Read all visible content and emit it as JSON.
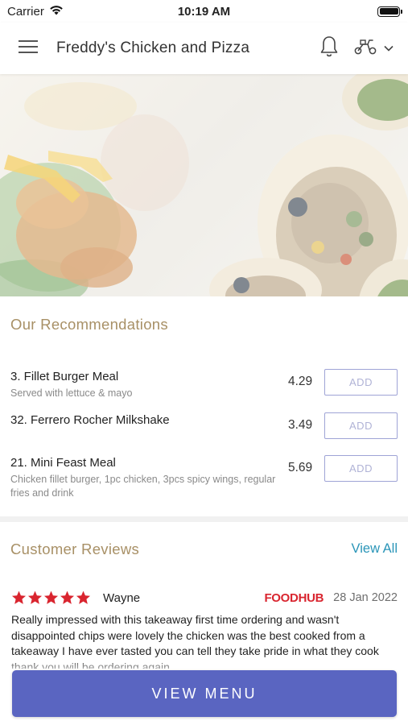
{
  "status_bar": {
    "carrier": "Carrier",
    "time": "10:19 AM"
  },
  "header": {
    "title": "Freddy's Chicken and Pizza",
    "icons": [
      "hamburger-menu-icon",
      "bell-icon",
      "scooter-icon",
      "chevron-down-icon"
    ]
  },
  "recommendations": {
    "title": "Our Recommendations",
    "add_label": "ADD",
    "items": [
      {
        "name": "3. Fillet Burger Meal",
        "description": "Served with lettuce & mayo",
        "price": "4.29"
      },
      {
        "name": "32. Ferrero Rocher Milkshake",
        "description": "",
        "price": "3.49"
      },
      {
        "name": "21. Mini Feast Meal",
        "description": "Chicken fillet burger, 1pc chicken, 3pcs spicy wings, regular fries and drink",
        "price": "5.69"
      }
    ]
  },
  "reviews": {
    "title": "Customer Reviews",
    "view_all": "View All",
    "items": [
      {
        "rating": 5,
        "reviewer": "Wayne",
        "source": "FOODHUB",
        "date": "28 Jan 2022",
        "text": "Really impressed with this takeaway first time ordering and wasn't disappointed chips were lovely the chicken was the best cooked from a takeaway I have ever tasted you can tell they take pride in what they cook thank you will be ordering again"
      }
    ]
  },
  "view_menu": "VIEW MENU",
  "colors": {
    "accent": "#5a65c1",
    "section_title": "#a89066",
    "link": "#2a95b8",
    "star": "#d9252f",
    "foodhub_red": "#d9252f"
  }
}
